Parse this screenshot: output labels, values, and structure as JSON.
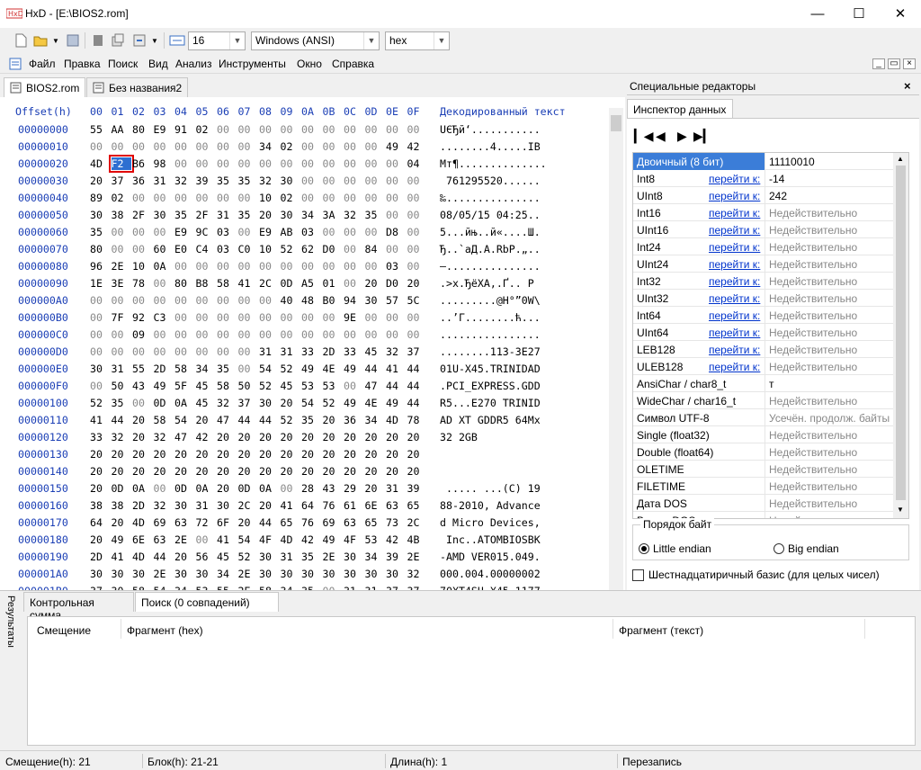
{
  "window": {
    "title": "HxD - [E:\\BIOS2.rom]"
  },
  "toolbar": {
    "bytes_per_row": "16",
    "charset": "Windows (ANSI)",
    "offset_base": "hex"
  },
  "menu": [
    "Файл",
    "Правка",
    "Поиск",
    "Вид",
    "Анализ",
    "Инструменты",
    "Окно",
    "Справка"
  ],
  "doc_tabs": [
    "BIOS2.rom",
    "Без названия2"
  ],
  "hex": {
    "offset_header": "Offset(h)",
    "columns": [
      "00",
      "01",
      "02",
      "03",
      "04",
      "05",
      "06",
      "07",
      "08",
      "09",
      "0A",
      "0B",
      "0C",
      "0D",
      "0E",
      "0F"
    ],
    "text_header": "Декодированный текст",
    "rows": [
      {
        "o": "00000000",
        "b": "55 AA 80 E9 91 02 00 00 00 00 00 00 00 00 00 00",
        "t": "UЄЂй‘..........."
      },
      {
        "o": "00000010",
        "b": "00 00 00 00 00 00 00 00 34 02 00 00 00 00 49 42",
        "t": "........4.....IB"
      },
      {
        "o": "00000020",
        "b": "4D F2 B6 98 00 00 00 00 00 00 00 00 00 00 00 04",
        "t": "Mт¶.............."
      },
      {
        "o": "00000030",
        "b": "20 37 36 31 32 39 35 35 32 30 00 00 00 00 00 00",
        "t": " 761295520......"
      },
      {
        "o": "00000040",
        "b": "89 02 00 00 00 00 00 00 10 02 00 00 00 00 00 00",
        "t": "‰..............."
      },
      {
        "o": "00000050",
        "b": "30 38 2F 30 35 2F 31 35 20 30 34 3A 32 35 00 00",
        "t": "08/05/15 04:25.."
      },
      {
        "o": "00000060",
        "b": "35 00 00 00 E9 9C 03 00 E9 AB 03 00 00 00 D8 00",
        "t": "5...йњ..й«....Ш."
      },
      {
        "o": "00000070",
        "b": "80 00 00 60 E0 C4 03 C0 10 52 62 D0 00 84 00 00",
        "t": "Ђ..`аД.А.RbР.„.."
      },
      {
        "o": "00000080",
        "b": "96 2E 10 0A 00 00 00 00 00 00 00 00 00 00 03 00",
        "t": "–..............."
      },
      {
        "o": "00000090",
        "b": "1E 3E 78 00 80 B8 58 41 2C 0D A5 01 00 20 D0 20",
        "t": ".>x.ЂёXA,.Ґ.. Р "
      },
      {
        "o": "000000A0",
        "b": "00 00 00 00 00 00 00 00 00 40 48 B0 94 30 57 5C",
        "t": ".........@H°”0W\\"
      },
      {
        "o": "000000B0",
        "b": "00 7F 92 C3 00 00 00 00 00 00 00 00 9E 00 00 00",
        "t": "..’Г........ћ..."
      },
      {
        "o": "000000C0",
        "b": "00 00 09 00 00 00 00 00 00 00 00 00 00 00 00 00",
        "t": "................"
      },
      {
        "o": "000000D0",
        "b": "00 00 00 00 00 00 00 00 31 31 33 2D 33 45 32 37",
        "t": "........113-3E27"
      },
      {
        "o": "000000E0",
        "b": "30 31 55 2D 58 34 35 00 54 52 49 4E 49 44 41 44",
        "t": "01U-X45.TRINIDAD"
      },
      {
        "o": "000000F0",
        "b": "00 50 43 49 5F 45 58 50 52 45 53 53 00 47 44 44",
        "t": ".PCI_EXPRESS.GDD"
      },
      {
        "o": "00000100",
        "b": "52 35 00 0D 0A 45 32 37 30 20 54 52 49 4E 49 44",
        "t": "R5...E270 TRINID"
      },
      {
        "o": "00000110",
        "b": "41 44 20 58 54 20 47 44 44 52 35 20 36 34 4D 78",
        "t": "AD XT GDDR5 64Mx"
      },
      {
        "o": "00000120",
        "b": "33 32 20 32 47 42 20 20 20 20 20 20 20 20 20 20",
        "t": "32 2GB"
      },
      {
        "o": "00000130",
        "b": "20 20 20 20 20 20 20 20 20 20 20 20 20 20 20 20",
        "t": ""
      },
      {
        "o": "00000140",
        "b": "20 20 20 20 20 20 20 20 20 20 20 20 20 20 20 20",
        "t": ""
      },
      {
        "o": "00000150",
        "b": "20 0D 0A 00 0D 0A 20 0D 0A 00 28 43 29 20 31 39",
        "t": " ..... ...(C) 19"
      },
      {
        "o": "00000160",
        "b": "38 38 2D 32 30 31 30 2C 20 41 64 76 61 6E 63 65",
        "t": "88-2010, Advance"
      },
      {
        "o": "00000170",
        "b": "64 20 4D 69 63 72 6F 20 44 65 76 69 63 65 73 2C",
        "t": "d Micro Devices,"
      },
      {
        "o": "00000180",
        "b": "20 49 6E 63 2E 00 41 54 4F 4D 42 49 4F 53 42 4B",
        "t": " Inc..ATOMBIOSBK"
      },
      {
        "o": "00000190",
        "b": "2D 41 4D 44 20 56 45 52 30 31 35 2E 30 34 39 2E",
        "t": "-AMD VER015.049."
      },
      {
        "o": "000001A0",
        "b": "30 30 30 2E 30 30 34 2E 30 30 30 30 30 30 30 32",
        "t": "000.004.00000002"
      },
      {
        "o": "000001B0",
        "b": "37 30 58 54 34 53 55 2E 58 34 35 00 31 31 37 37",
        "t": "70XT4SU.X45.1177"
      },
      {
        "o": "000001C0",
        "b": "31 35 38 20 00 33 32 36 33 31 35 20 20 00 20 20",
        "t": "158 .326315  .  "
      },
      {
        "o": "000001D0",
        "b": "20 20 20 20 20 20 00 53 41 50 50 48 49 52 45 5F",
        "t": "      .SAPPHIRE_"
      },
      {
        "o": "000001E0",
        "b": "54 52 49 4E 49 44 41 44 5F 45 32 37 31 5F 50 52",
        "t": "TRINIDAD_E271_PR"
      },
      {
        "o": "000001F0",
        "b": "4F 5F 41 30 5F 47 35 5F 32 47 5F 39 38 35 45 31",
        "t": "O_A0_G5_2G_985E1"
      }
    ]
  },
  "inspector": {
    "panel_title": "Специальные редакторы",
    "tab": "Инспектор данных",
    "rows": [
      {
        "name": "Двоичный (8 бит)",
        "link": "",
        "value": "11110010",
        "dim": false,
        "sel": true
      },
      {
        "name": "Int8",
        "link": "перейти к:",
        "value": "-14",
        "dim": false
      },
      {
        "name": "UInt8",
        "link": "перейти к:",
        "value": "242",
        "dim": false
      },
      {
        "name": "Int16",
        "link": "перейти к:",
        "value": "Недействительно",
        "dim": true
      },
      {
        "name": "UInt16",
        "link": "перейти к:",
        "value": "Недействительно",
        "dim": true
      },
      {
        "name": "Int24",
        "link": "перейти к:",
        "value": "Недействительно",
        "dim": true
      },
      {
        "name": "UInt24",
        "link": "перейти к:",
        "value": "Недействительно",
        "dim": true
      },
      {
        "name": "Int32",
        "link": "перейти к:",
        "value": "Недействительно",
        "dim": true
      },
      {
        "name": "UInt32",
        "link": "перейти к:",
        "value": "Недействительно",
        "dim": true
      },
      {
        "name": "Int64",
        "link": "перейти к:",
        "value": "Недействительно",
        "dim": true
      },
      {
        "name": "UInt64",
        "link": "перейти к:",
        "value": "Недействительно",
        "dim": true
      },
      {
        "name": "LEB128",
        "link": "перейти к:",
        "value": "Недействительно",
        "dim": true
      },
      {
        "name": "ULEB128",
        "link": "перейти к:",
        "value": "Недействительно",
        "dim": true
      },
      {
        "name": "AnsiChar / char8_t",
        "link": "",
        "value": "т",
        "dim": false
      },
      {
        "name": "WideChar / char16_t",
        "link": "",
        "value": "Недействительно",
        "dim": true
      },
      {
        "name": "Символ UTF-8",
        "link": "",
        "value": "Усечён. продолж. байты",
        "dim": true
      },
      {
        "name": "Single (float32)",
        "link": "",
        "value": "Недействительно",
        "dim": true
      },
      {
        "name": "Double (float64)",
        "link": "",
        "value": "Недействительно",
        "dim": true
      },
      {
        "name": "OLETIME",
        "link": "",
        "value": "Недействительно",
        "dim": true
      },
      {
        "name": "FILETIME",
        "link": "",
        "value": "Недействительно",
        "dim": true
      },
      {
        "name": "Дата DOS",
        "link": "",
        "value": "Недействительно",
        "dim": true
      },
      {
        "name": "Время DOS",
        "link": "",
        "value": "Недействительно",
        "dim": true
      }
    ],
    "byte_order_label": "Порядок байт",
    "little_endian": "Little endian",
    "big_endian": "Big endian",
    "hex_base_label": "Шестнадцатиричный базис (для целых чисел)"
  },
  "results": {
    "side_label": "Результаты",
    "tabs": [
      "Контрольная сумма",
      "Поиск (0 совпадений)"
    ],
    "columns": [
      "Смещение",
      "Фрагмент (hex)",
      "Фрагмент (текст)"
    ]
  },
  "status": {
    "offset": "Смещение(h): 21",
    "block": "Блок(h): 21-21",
    "length": "Длина(h): 1",
    "mode": "Перезапись"
  }
}
